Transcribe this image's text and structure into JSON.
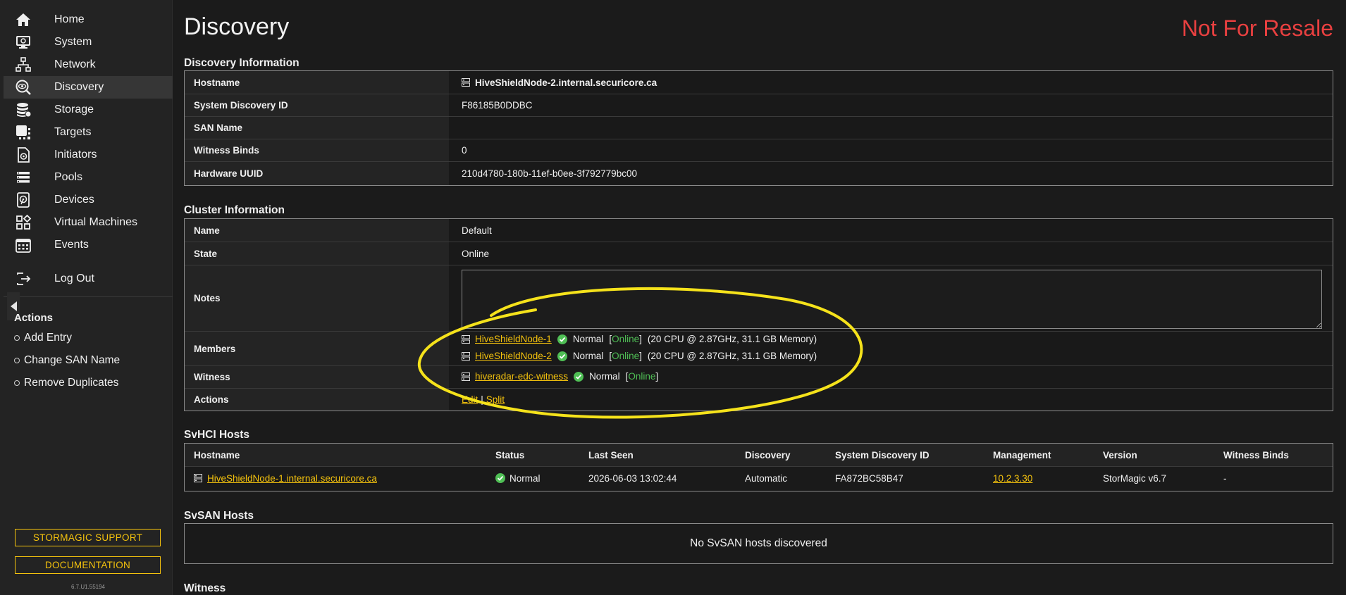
{
  "sidebar": {
    "nav": [
      {
        "label": "Home",
        "icon": "home-icon"
      },
      {
        "label": "System",
        "icon": "system-monitor-icon"
      },
      {
        "label": "Network",
        "icon": "network-icon"
      },
      {
        "label": "Discovery",
        "icon": "discovery-eye-icon",
        "active": true
      },
      {
        "label": "Storage",
        "icon": "storage-database-icon"
      },
      {
        "label": "Targets",
        "icon": "targets-icon"
      },
      {
        "label": "Initiators",
        "icon": "initiators-icon"
      },
      {
        "label": "Pools",
        "icon": "pools-icon"
      },
      {
        "label": "Devices",
        "icon": "devices-disk-icon"
      },
      {
        "label": "Virtual Machines",
        "icon": "virtual-machines-icon"
      },
      {
        "label": "Events",
        "icon": "events-calendar-icon"
      }
    ],
    "logout": {
      "label": "Log Out",
      "icon": "logout-icon"
    },
    "actions_heading": "Actions",
    "actions": [
      "Add Entry",
      "Change SAN Name",
      "Remove Duplicates"
    ],
    "support_button": "STORMAGIC SUPPORT",
    "docs_button": "DOCUMENTATION",
    "version": "6.7.U1.55194"
  },
  "page": {
    "title": "Discovery",
    "watermark": "Not For Resale"
  },
  "discovery_info": {
    "title": "Discovery Information",
    "rows": [
      {
        "key": "Hostname",
        "value": "HiveShieldNode-2.internal.securicore.ca"
      },
      {
        "key": "System Discovery ID",
        "value": "F86185B0DDBC"
      },
      {
        "key": "SAN Name",
        "value": ""
      },
      {
        "key": "Witness Binds",
        "value": "0"
      },
      {
        "key": "Hardware UUID",
        "value": "210d4780-180b-11ef-b0ee-3f792779bc00"
      }
    ]
  },
  "cluster_info": {
    "title": "Cluster Information",
    "name_key": "Name",
    "name_value": "Default",
    "state_key": "State",
    "state_value": "Online",
    "notes_key": "Notes",
    "notes_value": "",
    "members_key": "Members",
    "members": [
      {
        "name": "HiveShieldNode-1",
        "status": "Normal",
        "state": "Online",
        "specs": "(20 CPU @ 2.87GHz, 31.1 GB Memory)"
      },
      {
        "name": "HiveShieldNode-2",
        "status": "Normal",
        "state": "Online",
        "specs": "(20 CPU @ 2.87GHz, 31.1 GB Memory)"
      }
    ],
    "witness_key": "Witness",
    "witness": {
      "name": "hiveradar-edc-witness",
      "status": "Normal",
      "state": "Online"
    },
    "actions_key": "Actions",
    "action_edit": "Edit",
    "action_sep": "|",
    "action_split": "Split"
  },
  "svhci_hosts": {
    "title": "SvHCI Hosts",
    "columns": [
      "Hostname",
      "Status",
      "Last Seen",
      "Discovery",
      "System Discovery ID",
      "Management",
      "Version",
      "Witness Binds"
    ],
    "rows": [
      {
        "hostname": "HiveShieldNode-1.internal.securicore.ca",
        "status": "Normal",
        "last_seen": "2026-06-03 13:02:44",
        "discovery": "Automatic",
        "system_discovery_id": "FA872BC58B47",
        "management": "10.2.3.30",
        "version": "StorMagic v6.7",
        "witness_binds": "-"
      }
    ]
  },
  "svsan_hosts": {
    "title": "SvSAN Hosts",
    "empty_message": "No SvSAN hosts discovered"
  },
  "witness_section": {
    "title": "Witness"
  },
  "colors": {
    "accent": "#f4c20d",
    "online": "#4fbf55",
    "watermark": "#e84040",
    "annotation": "#f5e21b"
  }
}
